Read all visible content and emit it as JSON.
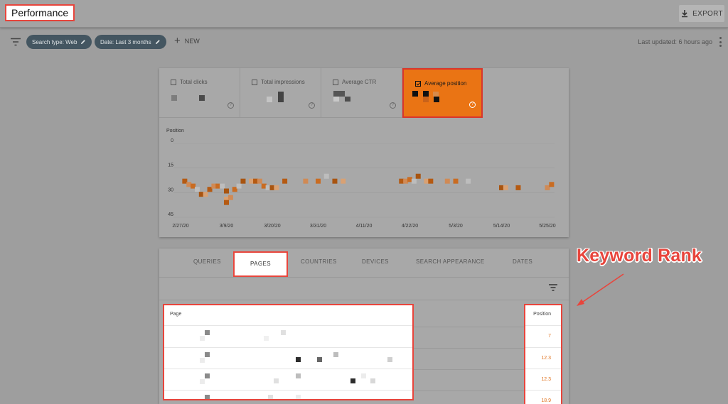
{
  "header": {
    "title": "Performance",
    "export_label": "EXPORT"
  },
  "filters": {
    "search_type_chip": "Search type: Web",
    "date_chip": "Date: Last 3 months",
    "new_label": "NEW",
    "last_updated": "Last updated: 6 hours ago"
  },
  "metrics": [
    {
      "label": "Total clicks",
      "checked": false
    },
    {
      "label": "Total impressions",
      "checked": false
    },
    {
      "label": "Average CTR",
      "checked": false
    },
    {
      "label": "Average position",
      "checked": true
    }
  ],
  "chart_data": {
    "type": "scatter",
    "ylabel": "Position",
    "y_ticks": [
      "0",
      "15",
      "30",
      "45"
    ],
    "ylim": [
      0,
      45
    ],
    "y_inverted": true,
    "x_ticks": [
      "2/27/20",
      "3/9/20",
      "3/20/20",
      "3/31/20",
      "4/11/20",
      "4/22/20",
      "5/3/20",
      "5/14/20",
      "5/25/20"
    ],
    "grid": true,
    "points": [
      {
        "date": "2/28/20",
        "y": 23
      },
      {
        "date": "2/29/20",
        "y": 25
      },
      {
        "date": "3/1/20",
        "y": 26
      },
      {
        "date": "3/2/20",
        "y": 28
      },
      {
        "date": "3/3/20",
        "y": 31
      },
      {
        "date": "3/4/20",
        "y": 31
      },
      {
        "date": "3/5/20",
        "y": 28
      },
      {
        "date": "3/6/20",
        "y": 26
      },
      {
        "date": "3/7/20",
        "y": 26
      },
      {
        "date": "3/8/20",
        "y": 26
      },
      {
        "date": "3/9/20",
        "y": 29
      },
      {
        "date": "3/9/20",
        "y": 34
      },
      {
        "date": "3/9/20",
        "y": 36
      },
      {
        "date": "3/10/20",
        "y": 33
      },
      {
        "date": "3/11/20",
        "y": 28
      },
      {
        "date": "3/12/20",
        "y": 26
      },
      {
        "date": "3/13/20",
        "y": 23
      },
      {
        "date": "3/15/20",
        "y": 23
      },
      {
        "date": "3/16/20",
        "y": 23
      },
      {
        "date": "3/17/20",
        "y": 23
      },
      {
        "date": "3/18/20",
        "y": 26
      },
      {
        "date": "3/19/20",
        "y": 27
      },
      {
        "date": "3/20/20",
        "y": 27
      },
      {
        "date": "3/21/20",
        "y": 27
      },
      {
        "date": "3/23/20",
        "y": 23
      },
      {
        "date": "3/28/20",
        "y": 23
      },
      {
        "date": "3/31/20",
        "y": 23
      },
      {
        "date": "4/2/20",
        "y": 20
      },
      {
        "date": "4/4/20",
        "y": 23
      },
      {
        "date": "4/6/20",
        "y": 23
      },
      {
        "date": "4/20/20",
        "y": 23
      },
      {
        "date": "4/21/20",
        "y": 23
      },
      {
        "date": "4/22/20",
        "y": 22
      },
      {
        "date": "4/23/20",
        "y": 23
      },
      {
        "date": "4/24/20",
        "y": 20
      },
      {
        "date": "4/26/20",
        "y": 23
      },
      {
        "date": "4/27/20",
        "y": 23
      },
      {
        "date": "5/1/20",
        "y": 23
      },
      {
        "date": "5/3/20",
        "y": 23
      },
      {
        "date": "5/6/20",
        "y": 23
      },
      {
        "date": "5/14/20",
        "y": 27
      },
      {
        "date": "5/15/20",
        "y": 27
      },
      {
        "date": "5/18/20",
        "y": 27
      },
      {
        "date": "5/25/20",
        "y": 27
      },
      {
        "date": "5/26/20",
        "y": 25
      }
    ]
  },
  "table": {
    "tabs": [
      "QUERIES",
      "PAGES",
      "COUNTRIES",
      "DEVICES",
      "SEARCH APPEARANCE",
      "DATES"
    ],
    "active_tab": "PAGES",
    "page_header": "Page",
    "position_header": "Position",
    "positions": [
      "7",
      "12.3",
      "12.3",
      "18.9"
    ]
  },
  "annotation": {
    "text": "Keyword Rank"
  },
  "colors": {
    "accent_orange": "#ea7414",
    "highlight_red": "#e8453c",
    "chip_bg": "#445661"
  }
}
